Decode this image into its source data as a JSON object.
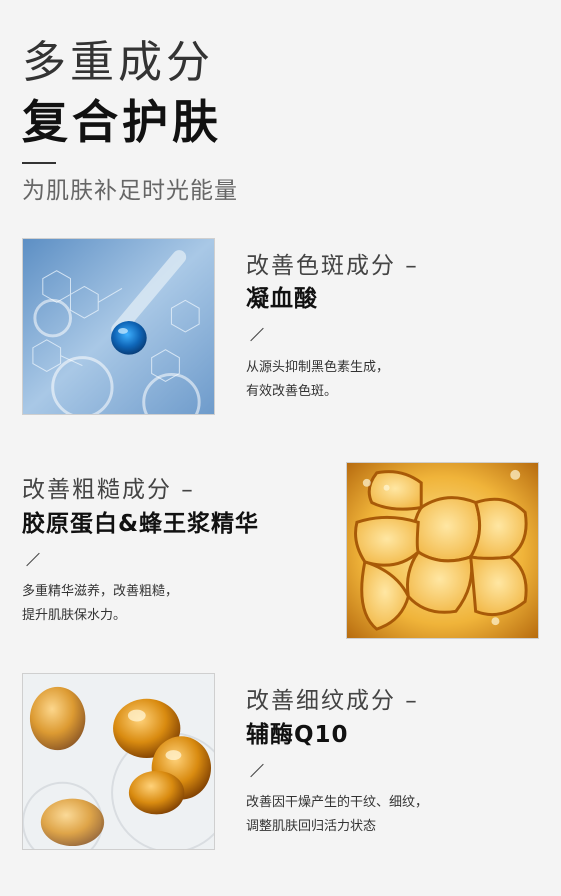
{
  "header": {
    "title_line1": "多重成分",
    "title_line2": "复合护肤",
    "subtitle": "为肌肤补足时光能量"
  },
  "sections": [
    {
      "label": "改善色斑成分 –",
      "name": "凝血酸",
      "desc_line1": "从源头抑制黑色素生成，",
      "desc_line2": "有效改善色斑。",
      "image_icon": "serum-dropper-image"
    },
    {
      "label": "改善粗糙成分 –",
      "name": "胶原蛋白&蜂王浆精华",
      "desc_line1": "多重精华滋养，改善粗糙，",
      "desc_line2": "提升肌肤保水力。",
      "image_icon": "golden-bubbles-image"
    },
    {
      "label": "改善细纹成分 –",
      "name": "辅酶Q10",
      "desc_line1": "改善因干燥产生的干纹、细纹，",
      "desc_line2": "调整肌肤回归活力状态",
      "image_icon": "oil-capsules-image"
    }
  ],
  "colors": {
    "background": "#f4f4f4",
    "blue_image": "#8fb6d9",
    "gold_image": "#e8a41f"
  }
}
